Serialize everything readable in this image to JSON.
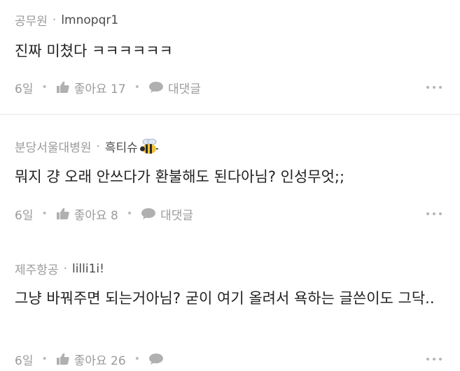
{
  "comments": [
    {
      "company": "공무원",
      "separator": "·",
      "author": "lmnopqr1",
      "text": "진짜 미쳤다 ㅋㅋㅋㅋㅋㅋ",
      "age": "6일",
      "like_label": "좋아요 17",
      "reply_label": "대댓글",
      "author_icon": null
    },
    {
      "company": "분당서울대병원",
      "separator": "·",
      "author": "흑티슈",
      "text": "뭐지 걍 오래 안쓰다가 환불해도 된다아님? 인성무엇;;",
      "age": "6일",
      "like_label": "좋아요 8",
      "reply_label": "대댓글",
      "author_icon": "bee-icon"
    },
    {
      "company": "제주항공",
      "separator": "·",
      "author": "lilli1i!",
      "text": "그냥 바꿔주면 되는거아님? 굳이 여기 올려서 욕하는 글쓴이도 그닥..",
      "age": "6일",
      "like_label": "좋아요 26",
      "reply_label": "",
      "author_icon": null
    }
  ],
  "icons": {
    "like": "thumbs-up-icon",
    "reply": "speech-bubble-icon",
    "more": "more-dots-icon"
  },
  "colors": {
    "meta": "#8a8a8a",
    "text": "#222222",
    "muted": "#9b9b9b",
    "divider": "#e6e6e6"
  }
}
